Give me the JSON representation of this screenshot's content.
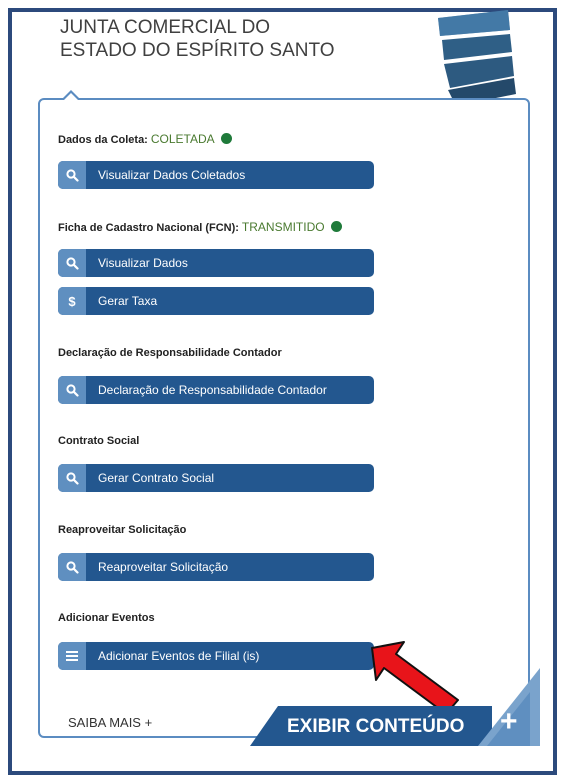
{
  "header": {
    "title_line1": "JUNTA COMERCIAL DO",
    "title_line2": "ESTADO DO ESPÍRITO SANTO"
  },
  "sections": {
    "coleta": {
      "label": "Dados da Coleta:",
      "status": "COLETADA",
      "status_color": "#1f7a3a",
      "btn_visualizar": "Visualizar Dados Coletados"
    },
    "fcn": {
      "label": "Ficha de Cadastro Nacional (FCN):",
      "status": "TRANSMITIDO",
      "status_color": "#1f7a3a",
      "btn_visualizar": "Visualizar Dados",
      "btn_taxa": "Gerar Taxa"
    },
    "declaracao": {
      "label": "Declaração de Responsabilidade Contador",
      "btn": "Declaração de Responsabilidade Contador"
    },
    "contrato": {
      "label": "Contrato Social",
      "btn": "Gerar Contrato Social"
    },
    "reaproveitar": {
      "label": "Reaproveitar Solicitação",
      "btn": "Reaproveitar Solicitação"
    },
    "eventos": {
      "label": "Adicionar Eventos",
      "btn": "Adicionar Eventos de Filial (is)"
    }
  },
  "footer": {
    "saiba_mais": "SAIBA MAIS +",
    "exibir": "EXIBIR CONTEÚDO",
    "plus": "+"
  },
  "icons": {
    "search": "search-icon",
    "dollar": "$",
    "menu": "menu-icon"
  },
  "colors": {
    "button": "#23578f",
    "icon_bg": "#5f8fc0",
    "frame": "#2c4a7c",
    "arrow": "#e8141a"
  }
}
